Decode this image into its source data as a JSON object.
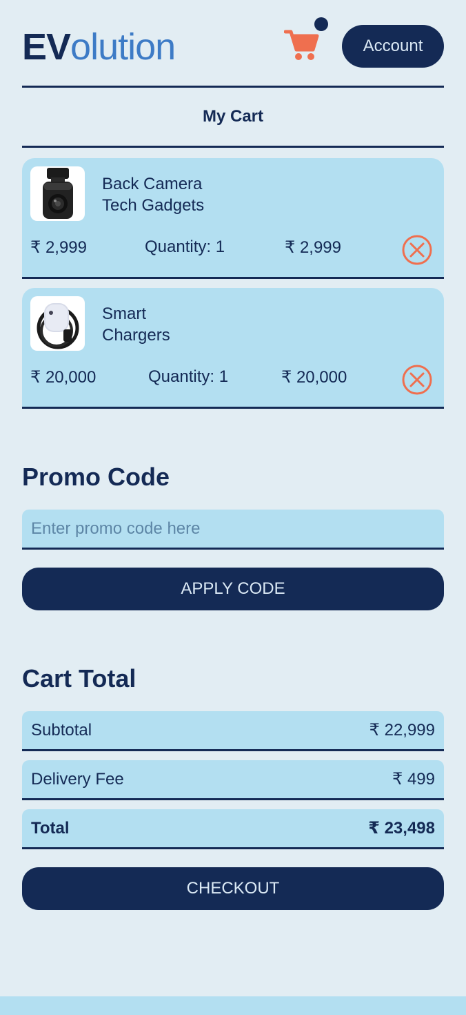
{
  "header": {
    "logo_bold": "EV",
    "logo_rest": "olution",
    "account_label": "Account",
    "cart_icon": "shopping-cart-icon"
  },
  "page_title": "My Cart",
  "cart_items": [
    {
      "name_line1": "Back Camera",
      "name_line2": "Tech Gadgets",
      "price": "₹ 2,999",
      "quantity": "Quantity: 1",
      "total": "₹ 2,999",
      "image": "dash-camera-image",
      "remove_icon": "close-circle-icon"
    },
    {
      "name_line1": "Smart",
      "name_line2": "Chargers",
      "price": "₹ 20,000",
      "quantity": "Quantity: 1",
      "total": "₹ 20,000",
      "image": "ev-charger-image",
      "remove_icon": "close-circle-icon"
    }
  ],
  "promo": {
    "heading": "Promo Code",
    "placeholder": "Enter promo code here",
    "value": "",
    "apply_label": "APPLY CODE"
  },
  "cart_total": {
    "heading": "Cart Total",
    "subtotal_label": "Subtotal",
    "subtotal_value": "₹ 22,999",
    "delivery_label": "Delivery Fee",
    "delivery_value": "₹ 499",
    "total_label": "Total",
    "total_value": "₹ 23,498"
  },
  "checkout_label": "CHECKOUT",
  "colors": {
    "background": "#e2edf3",
    "navy": "#142a55",
    "light_blue": "#b3dff1",
    "logo_blue": "#3d7bc6",
    "accent_orange": "#ef6f4f"
  }
}
